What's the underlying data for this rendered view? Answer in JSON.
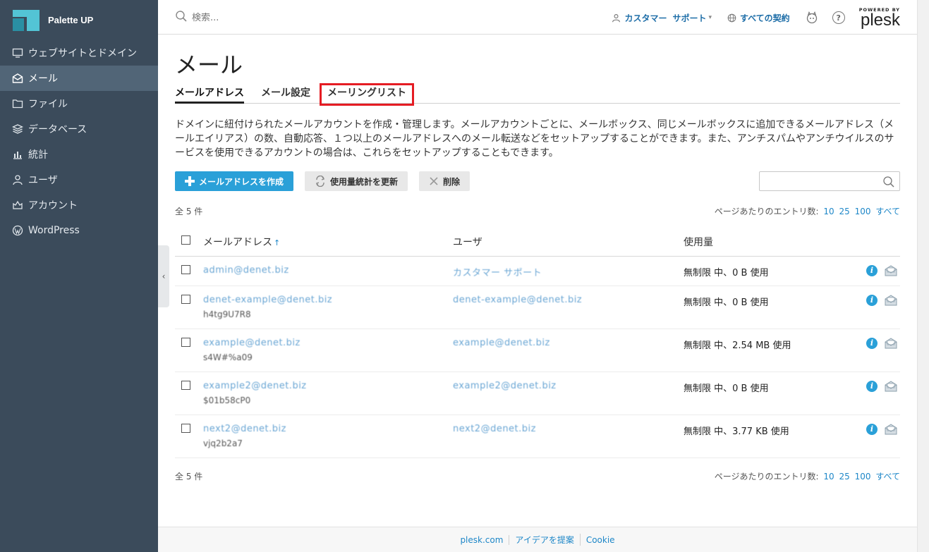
{
  "brand": {
    "name": "Palette UP"
  },
  "sidebar": {
    "items": [
      {
        "label": "ウェブサイトとドメイン",
        "icon": "monitor-icon"
      },
      {
        "label": "メール",
        "icon": "mail-icon",
        "active": true
      },
      {
        "label": "ファイル",
        "icon": "file-icon"
      },
      {
        "label": "データベース",
        "icon": "database-icon"
      },
      {
        "label": "統計",
        "icon": "stats-icon"
      },
      {
        "label": "ユーザ",
        "icon": "user-icon"
      },
      {
        "label": "アカウント",
        "icon": "account-icon"
      },
      {
        "label": "WordPress",
        "icon": "wordpress-icon"
      }
    ]
  },
  "header": {
    "search_placeholder": "検索...",
    "customer_label": "カスタマー",
    "support_label": "サポート",
    "subscriptions_label": "すべての契約",
    "powered_by": "POWERED BY",
    "plesk": "plesk"
  },
  "page": {
    "title": "メール",
    "tabs": [
      "メールアドレス",
      "メール設定",
      "メーリングリスト"
    ],
    "description": "ドメインに紐付けられたメールアカウントを作成・管理します。メールアカウントごとに、メールボックス、同じメールボックスに追加できるメールアドレス（メールエイリアス）の数、自動応答、１つ以上のメールアドレスへのメール転送などをセットアップすることができます。また、アンチスパムやアンチウイルスのサービスを使用できるアカウントの場合は、これらをセットアップすることもできます。"
  },
  "toolbar": {
    "create_label": "メールアドレスを作成",
    "refresh_label": "使用量統計を更新",
    "delete_label": "削除"
  },
  "list": {
    "total": "全 5 件",
    "per_page_label": "ページあたりのエントリ数:",
    "per_page_options": [
      "10",
      "25",
      "100",
      "すべて"
    ],
    "columns": {
      "mail": "メールアドレス",
      "user": "ユーザ",
      "usage": "使用量"
    },
    "rows": [
      {
        "mail": "admin@denet.biz",
        "sub": "",
        "user": "カスタマー サポート",
        "usage": "無制限 中、0 B 使用"
      },
      {
        "mail": "denet-example@denet.biz",
        "sub": "h4tg9U7R8",
        "user": "denet-example@denet.biz",
        "usage": "無制限 中、0 B 使用"
      },
      {
        "mail": "example@denet.biz",
        "sub": "s4W#%a09",
        "user": "example@denet.biz",
        "usage": "無制限 中、2.54 MB 使用"
      },
      {
        "mail": "example2@denet.biz",
        "sub": "$01b58cP0",
        "user": "example2@denet.biz",
        "usage": "無制限 中、0 B 使用"
      },
      {
        "mail": "next2@denet.biz",
        "sub": "vjq2b2a7",
        "user": "next2@denet.biz",
        "usage": "無制限 中、3.77 KB 使用"
      }
    ]
  },
  "footer": {
    "links": [
      "plesk.com",
      "アイデアを提案",
      "Cookie"
    ]
  }
}
